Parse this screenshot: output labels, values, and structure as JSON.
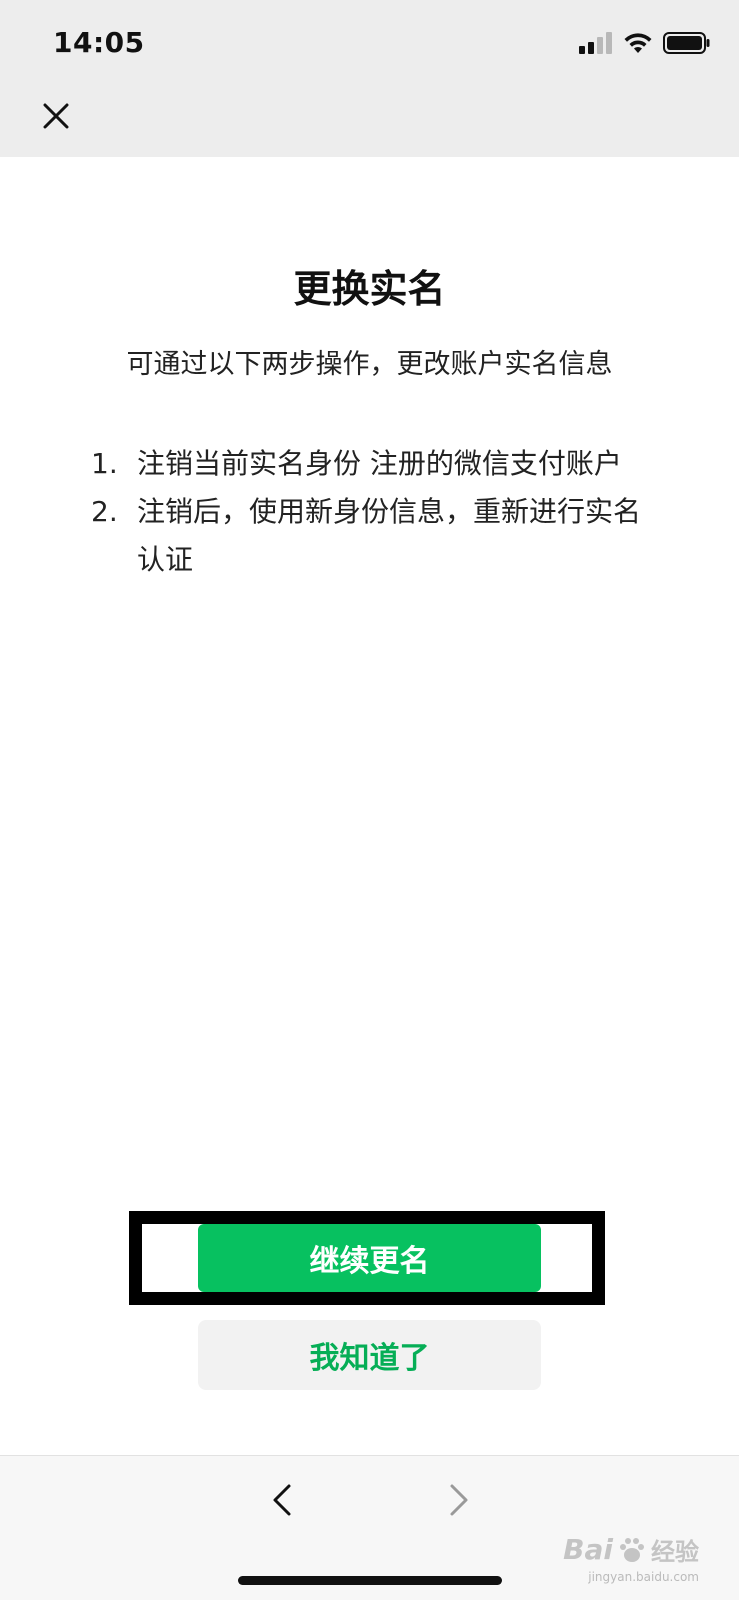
{
  "status_bar": {
    "time": "14:05",
    "icons": [
      "cellular-signal-icon",
      "wifi-icon",
      "battery-icon"
    ]
  },
  "header": {
    "close_icon": "close-icon"
  },
  "content": {
    "title": "更换实名",
    "subtitle": "可通过以下两步操作，更改账户实名信息",
    "steps": [
      {
        "num": "1.",
        "text": "注销当前实名身份 注册的微信支付账户"
      },
      {
        "num": "2.",
        "text": "注销后，使用新身份信息，重新进行实名认证"
      }
    ]
  },
  "actions": {
    "primary_label": "继续更名",
    "secondary_label": "我知道了"
  },
  "bottom_nav": {
    "back_icon": "chevron-left-icon",
    "forward_icon": "chevron-right-icon"
  },
  "watermark": {
    "brand": "Bai",
    "suffix": "经验",
    "url": "jingyan.baidu.com"
  },
  "colors": {
    "primary_green": "#07c160",
    "secondary_text_green": "#06ae56",
    "topbar_bg": "#ededed",
    "highlight_frame": "#000000"
  }
}
